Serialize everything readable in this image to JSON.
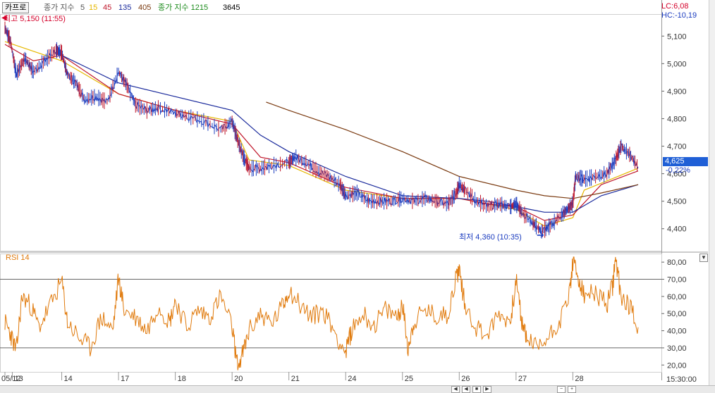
{
  "toolbar": {
    "symbol": "카프로",
    "legend": [
      {
        "label": "종가 지수",
        "color": "#555555"
      },
      {
        "label": "5",
        "color": "#555555"
      },
      {
        "label": "15",
        "color": "#e6b800"
      },
      {
        "label": "45",
        "color": "#c0182c"
      },
      {
        "label": "135",
        "color": "#1a2a9c"
      },
      {
        "label": "405",
        "color": "#7a3a10"
      },
      {
        "label": "종가 지수 1215",
        "color": "#1a8a1a"
      },
      {
        "label": "3645",
        "color": "#000000"
      }
    ],
    "lc": "LC:6,08",
    "hc": "HC:-10,19"
  },
  "annotations": {
    "high": "최고 5,150 (11:55)",
    "low": "최저 4,360 (10:35)",
    "last_price": "4,625",
    "change_pct": "-0,22%",
    "time": "15:30:00"
  },
  "chart_data": [
    {
      "type": "candlestick",
      "title": "카프로",
      "ylim": [
        4320,
        5180
      ],
      "y_ticks": [
        "5,100",
        "5,000",
        "4,900",
        "4,800",
        "4,700",
        "4,600",
        "4,500",
        "4,400"
      ],
      "y_tick_values": [
        5100,
        5000,
        4900,
        4800,
        4700,
        4600,
        4500,
        4400
      ],
      "x_tick_labels": [
        "05/12",
        "13",
        "14",
        "17",
        "18",
        "20",
        "21",
        "24",
        "25",
        "26",
        "27",
        "28"
      ],
      "x_tick_positions": [
        0.0,
        0.13,
        1.0,
        2.0,
        3.0,
        4.0,
        5.0,
        6.0,
        7.0,
        8.0,
        9.0,
        10.0
      ],
      "x_range": [
        0,
        11.15
      ],
      "price_path": [
        [
          0.0,
          5130
        ],
        [
          0.1,
          5080
        ],
        [
          0.2,
          4960
        ],
        [
          0.35,
          5020
        ],
        [
          0.5,
          4970
        ],
        [
          0.7,
          5010
        ],
        [
          0.9,
          5050
        ],
        [
          1.0,
          5040
        ],
        [
          1.1,
          4960
        ],
        [
          1.25,
          4930
        ],
        [
          1.4,
          4870
        ],
        [
          1.6,
          4880
        ],
        [
          1.8,
          4860
        ],
        [
          2.0,
          4970
        ],
        [
          2.15,
          4920
        ],
        [
          2.3,
          4850
        ],
        [
          2.5,
          4830
        ],
        [
          2.7,
          4840
        ],
        [
          3.0,
          4820
        ],
        [
          3.2,
          4810
        ],
        [
          3.5,
          4790
        ],
        [
          3.8,
          4760
        ],
        [
          4.0,
          4790
        ],
        [
          4.1,
          4720
        ],
        [
          4.2,
          4660
        ],
        [
          4.3,
          4620
        ],
        [
          4.5,
          4620
        ],
        [
          4.7,
          4630
        ],
        [
          5.0,
          4640
        ],
        [
          5.1,
          4660
        ],
        [
          5.3,
          4640
        ],
        [
          5.5,
          4610
        ],
        [
          5.7,
          4590
        ],
        [
          5.9,
          4560
        ],
        [
          6.0,
          4520
        ],
        [
          6.2,
          4530
        ],
        [
          6.4,
          4500
        ],
        [
          6.6,
          4500
        ],
        [
          6.8,
          4500
        ],
        [
          7.0,
          4510
        ],
        [
          7.2,
          4500
        ],
        [
          7.4,
          4510
        ],
        [
          7.6,
          4500
        ],
        [
          7.8,
          4490
        ],
        [
          7.95,
          4530
        ],
        [
          8.0,
          4560
        ],
        [
          8.1,
          4540
        ],
        [
          8.3,
          4500
        ],
        [
          8.5,
          4480
        ],
        [
          8.7,
          4490
        ],
        [
          8.9,
          4480
        ],
        [
          9.0,
          4490
        ],
        [
          9.1,
          4460
        ],
        [
          9.3,
          4420
        ],
        [
          9.45,
          4390
        ],
        [
          9.6,
          4410
        ],
        [
          9.8,
          4450
        ],
        [
          9.9,
          4470
        ],
        [
          10.0,
          4490
        ],
        [
          10.05,
          4590
        ],
        [
          10.2,
          4580
        ],
        [
          10.4,
          4590
        ],
        [
          10.6,
          4600
        ],
        [
          10.75,
          4650
        ],
        [
          10.85,
          4700
        ],
        [
          11.0,
          4670
        ],
        [
          11.15,
          4625
        ]
      ],
      "moving_averages": [
        {
          "name": "15",
          "color": "#e6b800",
          "path": [
            [
              0.0,
              5080
            ],
            [
              1.0,
              5010
            ],
            [
              2.0,
              4890
            ],
            [
              3.0,
              4830
            ],
            [
              4.0,
              4790
            ],
            [
              4.3,
              4650
            ],
            [
              5.0,
              4630
            ],
            [
              6.0,
              4540
            ],
            [
              7.0,
              4510
            ],
            [
              8.0,
              4510
            ],
            [
              9.0,
              4470
            ],
            [
              9.5,
              4410
            ],
            [
              10.0,
              4440
            ],
            [
              10.2,
              4540
            ],
            [
              11.15,
              4620
            ]
          ]
        },
        {
          "name": "45",
          "color": "#c0182c",
          "path": [
            [
              0.0,
              5070
            ],
            [
              0.5,
              5010
            ],
            [
              1.0,
              5030
            ],
            [
              2.0,
              4890
            ],
            [
              3.0,
              4830
            ],
            [
              4.0,
              4780
            ],
            [
              4.5,
              4660
            ],
            [
              5.0,
              4640
            ],
            [
              6.0,
              4550
            ],
            [
              7.0,
              4510
            ],
            [
              8.0,
              4510
            ],
            [
              8.5,
              4490
            ],
            [
              9.0,
              4480
            ],
            [
              9.5,
              4430
            ],
            [
              10.0,
              4450
            ],
            [
              10.5,
              4560
            ],
            [
              11.15,
              4610
            ]
          ]
        },
        {
          "name": "135",
          "color": "#1a2a9c",
          "path": [
            [
              1.0,
              5030
            ],
            [
              2.0,
              4930
            ],
            [
              3.0,
              4880
            ],
            [
              4.0,
              4830
            ],
            [
              4.5,
              4740
            ],
            [
              5.0,
              4680
            ],
            [
              6.0,
              4590
            ],
            [
              7.0,
              4520
            ],
            [
              8.0,
              4510
            ],
            [
              8.5,
              4500
            ],
            [
              9.0,
              4480
            ],
            [
              9.5,
              4460
            ],
            [
              10.0,
              4460
            ],
            [
              10.5,
              4520
            ],
            [
              11.15,
              4560
            ]
          ]
        },
        {
          "name": "405",
          "color": "#7a3a10",
          "path": [
            [
              4.6,
              4860
            ],
            [
              5.0,
              4830
            ],
            [
              6.0,
              4760
            ],
            [
              7.0,
              4680
            ],
            [
              8.0,
              4590
            ],
            [
              9.0,
              4540
            ],
            [
              9.5,
              4520
            ],
            [
              10.0,
              4510
            ],
            [
              10.5,
              4530
            ],
            [
              11.15,
              4560
            ]
          ]
        }
      ]
    },
    {
      "type": "line",
      "title": "RSI 14",
      "ylim": [
        16,
        85
      ],
      "y_ticks": [
        "80,00",
        "70,00",
        "60,00",
        "50,00",
        "40,00",
        "30,00",
        "20,00"
      ],
      "y_tick_values": [
        80,
        70,
        60,
        50,
        40,
        30,
        20
      ],
      "reference_lines": [
        70,
        30
      ],
      "x_range": [
        0,
        11.15
      ],
      "series": [
        {
          "color": "#e07a0c",
          "values": [
            [
              0.0,
              45
            ],
            [
              0.1,
              38
            ],
            [
              0.2,
              28
            ],
            [
              0.3,
              60
            ],
            [
              0.45,
              55
            ],
            [
              0.6,
              42
            ],
            [
              0.8,
              55
            ],
            [
              1.0,
              69
            ],
            [
              1.1,
              45
            ],
            [
              1.3,
              36
            ],
            [
              1.5,
              30
            ],
            [
              1.7,
              48
            ],
            [
              1.9,
              40
            ],
            [
              2.0,
              71
            ],
            [
              2.1,
              52
            ],
            [
              2.3,
              48
            ],
            [
              2.5,
              40
            ],
            [
              2.7,
              55
            ],
            [
              2.9,
              45
            ],
            [
              3.0,
              58
            ],
            [
              3.2,
              42
            ],
            [
              3.4,
              52
            ],
            [
              3.6,
              48
            ],
            [
              3.8,
              60
            ],
            [
              4.0,
              42
            ],
            [
              4.1,
              18
            ],
            [
              4.2,
              28
            ],
            [
              4.3,
              40
            ],
            [
              4.5,
              50
            ],
            [
              4.7,
              44
            ],
            [
              4.9,
              55
            ],
            [
              5.0,
              64
            ],
            [
              5.2,
              55
            ],
            [
              5.4,
              48
            ],
            [
              5.6,
              52
            ],
            [
              5.8,
              40
            ],
            [
              6.0,
              27
            ],
            [
              6.1,
              40
            ],
            [
              6.3,
              50
            ],
            [
              6.5,
              43
            ],
            [
              6.7,
              52
            ],
            [
              6.9,
              48
            ],
            [
              7.0,
              55
            ],
            [
              7.1,
              30
            ],
            [
              7.2,
              45
            ],
            [
              7.4,
              52
            ],
            [
              7.6,
              48
            ],
            [
              7.8,
              50
            ],
            [
              7.95,
              72
            ],
            [
              8.0,
              76
            ],
            [
              8.1,
              55
            ],
            [
              8.3,
              42
            ],
            [
              8.5,
              38
            ],
            [
              8.7,
              50
            ],
            [
              8.9,
              45
            ],
            [
              9.0,
              70
            ],
            [
              9.1,
              45
            ],
            [
              9.2,
              35
            ],
            [
              9.4,
              30
            ],
            [
              9.6,
              38
            ],
            [
              9.8,
              48
            ],
            [
              9.95,
              64
            ],
            [
              10.0,
              80
            ],
            [
              10.1,
              70
            ],
            [
              10.2,
              60
            ],
            [
              10.4,
              62
            ],
            [
              10.6,
              55
            ],
            [
              10.7,
              66
            ],
            [
              10.75,
              82
            ],
            [
              10.85,
              60
            ],
            [
              11.0,
              55
            ],
            [
              11.15,
              42
            ]
          ]
        }
      ]
    }
  ]
}
